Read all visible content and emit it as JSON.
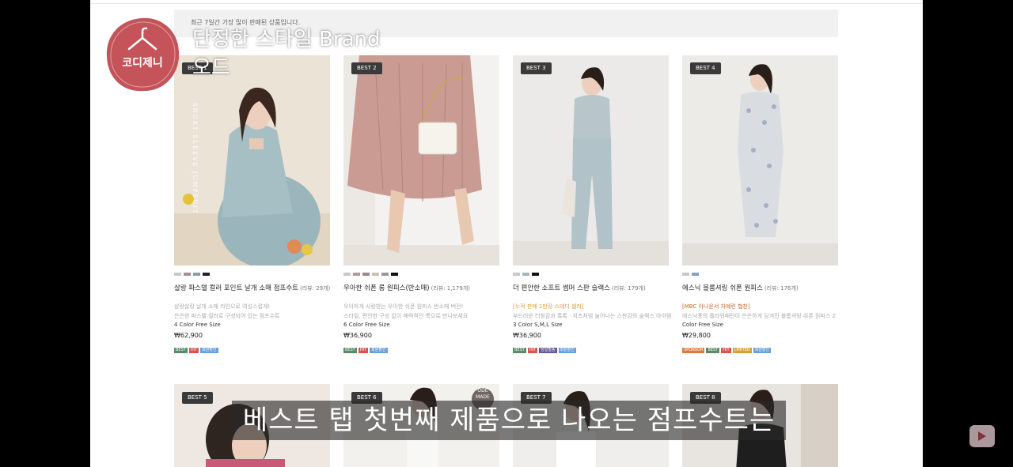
{
  "notice": {
    "text": "최근 7일간 가장 많이 판매된 상품입니다."
  },
  "overlay": {
    "logo_text": "코디제니",
    "title_line1": "단정한 스타일 Brand",
    "title_line2": "오드",
    "subtitle": "베스트 탭 첫번째 제품으로 나오는 점프수트는"
  },
  "products": [
    {
      "badge": "BEST 1",
      "swatches": [
        "#c8c8c8",
        "#a89090",
        "#8aa0a8",
        "#222222"
      ],
      "name": "살랑 파스텔 컬러 포인트 날개 소매 점프수트",
      "reviews": "(리뷰: 29개)",
      "desc1": "살랑살랑 날개 소매 라인으로 여성스럽게!",
      "desc2": "은은한 파스텔 컬러로 구성되어 있는 점프수트",
      "sizes": "4 Color Free Size",
      "price": "₩62,900",
      "tags": [
        "BEST",
        "HIT",
        "회원할인"
      ],
      "image_text": "SHORT SLEEVE JUMPSUIT"
    },
    {
      "badge": "BEST 2",
      "swatches": [
        "#c8c8c8",
        "#b49a9a",
        "#9a8a8a",
        "#c8c0b0",
        "#999999",
        "#111111"
      ],
      "name": "우아한 쉬폰 롱 원피스(반소매)",
      "reviews": "(리뷰: 1,179개)",
      "desc1": "우아하게 사랑받는 우아한 쉬폰 원피스 반소매 버전!",
      "desc2": "스타일, 편안한 구성 없이 매력적인 룩으로 만나보세요",
      "sizes": "6 Color Free Size",
      "price": "₩36,900",
      "tags": [
        "BEST",
        "HIT",
        "회원할인"
      ]
    },
    {
      "badge": "BEST 3",
      "swatches": [
        "#c8c8c8",
        "#a8b4bc",
        "#111111"
      ],
      "name": "더 편안한 소프트 썸머 스판 슬랙스",
      "reviews": "(리뷰: 179개)",
      "desc1": "[누적 판매 1만장 스테디 셀러]",
      "desc2": "부드러운 터칭감과 톡톡 · 지즈처럼 늘어나는 스판감의 슬랙스 아이템",
      "sizes": "3 Color S,M,L Size",
      "price": "₩36,900",
      "tags": [
        "BEST",
        "HIT",
        "당일발송",
        "회원할인"
      ]
    },
    {
      "badge": "BEST 4",
      "swatches": [
        "#c8c8c8",
        "#8aa0c0"
      ],
      "name": "에스닉 블룸셔링 쉬폰 원피스",
      "reviews": "(리뷰: 176개)",
      "desc1": "[MBC 아나운서 차예련 협찬]",
      "desc2": "에스닉풍의 플라워패턴이 은은하게 담겨진 블룸셔링 쉬폰 원피스 2",
      "sizes": "Color Free Size",
      "price": "₩29,800",
      "tags": [
        "SPONSOR",
        "BEST",
        "HIT",
        "LIMITED",
        "회원할인"
      ]
    }
  ],
  "products_row2": [
    {
      "badge": "BEST 5"
    },
    {
      "badge": "BEST 6",
      "mark": "ODE MADE"
    },
    {
      "badge": "BEST 7"
    },
    {
      "badge": "BEST 8"
    }
  ],
  "colors": {
    "tag_best": "#5a8a6a",
    "tag_hit": "#d9534f",
    "tag_member": "#6aa0d8",
    "tag_sponsor": "#e07a3a",
    "tag_limited": "#d8a030",
    "tag_sameday": "#6a5a9a"
  }
}
